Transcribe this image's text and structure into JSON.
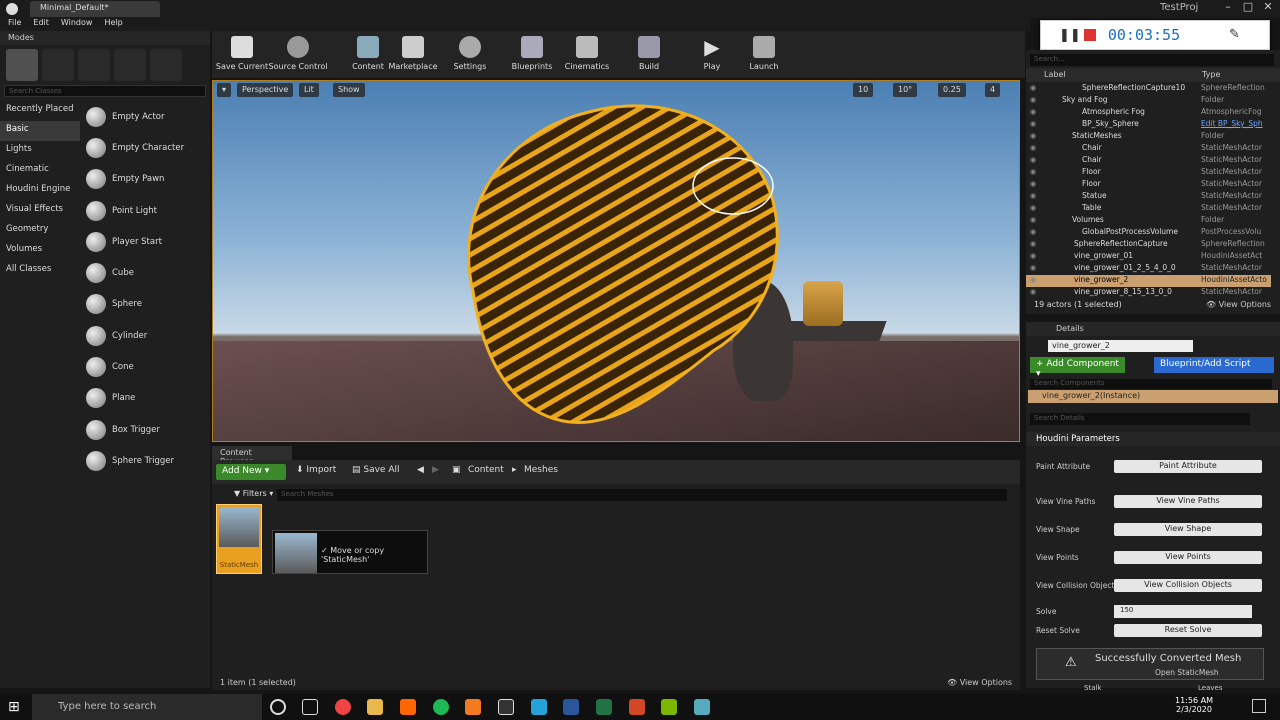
{
  "window": {
    "tab_title": "Minimal_Default*",
    "project": "TestProj"
  },
  "menu": [
    "File",
    "Edit",
    "Window",
    "Help"
  ],
  "recorder": {
    "time": "00:03:55"
  },
  "modes": {
    "tab_label": "Modes",
    "search_placeholder": "Search Classes",
    "categories": [
      "Recently Placed",
      "Basic",
      "Lights",
      "Cinematic",
      "Houdini Engine",
      "Visual Effects",
      "Geometry",
      "Volumes",
      "All Classes"
    ],
    "items": [
      "Empty Actor",
      "Empty Character",
      "Empty Pawn",
      "Point Light",
      "Player Start",
      "Cube",
      "Sphere",
      "Cylinder",
      "Cone",
      "Plane",
      "Box Trigger",
      "Sphere Trigger"
    ]
  },
  "toolbar": [
    "Save Current",
    "Source Control",
    "Content",
    "Marketplace",
    "Settings",
    "Blueprints",
    "Cinematics",
    "Build",
    "Play",
    "Launch"
  ],
  "viewport": {
    "perspective": "Perspective",
    "lit": "Lit",
    "show": "Show",
    "grid": "10",
    "angle": "10°",
    "scale": "0.25",
    "speed": "4"
  },
  "content_browser": {
    "tab_label": "Content Browser",
    "add_new": "Add New",
    "import": "Import",
    "save_all": "Save All",
    "path": [
      "Content",
      "Meshes"
    ],
    "filters": "Filters",
    "search_placeholder": "Search Meshes",
    "asset_label": "StaticMesh",
    "drag_tip": "Move or copy 'StaticMesh'",
    "status": "1 item (1 selected)",
    "view_options": "View Options"
  },
  "outliner": {
    "search_placeholder": "Search...",
    "col_label": "Label",
    "col_type": "Type",
    "rows": [
      {
        "label": "SphereReflectionCapture10",
        "type": "SphereReflection"
      },
      {
        "label": "Sky and Fog",
        "type": "Folder"
      },
      {
        "label": "Atmospheric Fog",
        "type": "AtmosphericFog"
      },
      {
        "label": "BP_Sky_Sphere",
        "type": "Edit BP_Sky_Sph"
      },
      {
        "label": "StaticMeshes",
        "type": "Folder"
      },
      {
        "label": "Chair",
        "type": "StaticMeshActor"
      },
      {
        "label": "Chair",
        "type": "StaticMeshActor"
      },
      {
        "label": "Floor",
        "type": "StaticMeshActor"
      },
      {
        "label": "Floor",
        "type": "StaticMeshActor"
      },
      {
        "label": "Statue",
        "type": "StaticMeshActor"
      },
      {
        "label": "Table",
        "type": "StaticMeshActor"
      },
      {
        "label": "Volumes",
        "type": "Folder"
      },
      {
        "label": "GlobalPostProcessVolume",
        "type": "PostProcessVolu"
      },
      {
        "label": "SphereReflectionCapture",
        "type": "SphereReflection"
      },
      {
        "label": "vine_grower_01",
        "type": "HoudiniAssetAct"
      },
      {
        "label": "vine_grower_01_2_5_4_0_0",
        "type": "StaticMeshActor"
      },
      {
        "label": "vine_grower_2",
        "type": "HoudiniAssetActo"
      },
      {
        "label": "vine_grower_8_15_13_0_0",
        "type": "StaticMeshActor"
      }
    ],
    "status": "19 actors (1 selected)",
    "view_options": "View Options"
  },
  "details": {
    "tab_label": "Details",
    "name": "vine_grower_2",
    "add_component": "Add Component",
    "blueprint": "Blueprint/Add Script",
    "comp_search": "Search Components",
    "instance": "vine_grower_2(Instance)",
    "detail_search": "Search Details",
    "section": "Houdini Parameters",
    "params": [
      {
        "label": "Paint Attribute",
        "button": "Paint Attribute"
      },
      {
        "label": "View Vine Paths",
        "button": "View Vine Paths"
      },
      {
        "label": "View Shape",
        "button": "View Shape"
      },
      {
        "label": "View Points",
        "button": "View Points"
      },
      {
        "label": "View Collision Objects",
        "button": "View Collision Objects"
      }
    ],
    "solve_label": "Solve",
    "solve_value": "150",
    "reset_label": "Reset Solve",
    "reset_button": "Reset Solve",
    "toast": "Successfully Converted Mesh",
    "toast_link": "Open StaticMesh",
    "bottom_left": "Stalk",
    "bottom_right": "Leaves"
  },
  "taskbar": {
    "search": "Type here to search",
    "time": "11:56 AM",
    "date": "2/3/2020"
  }
}
